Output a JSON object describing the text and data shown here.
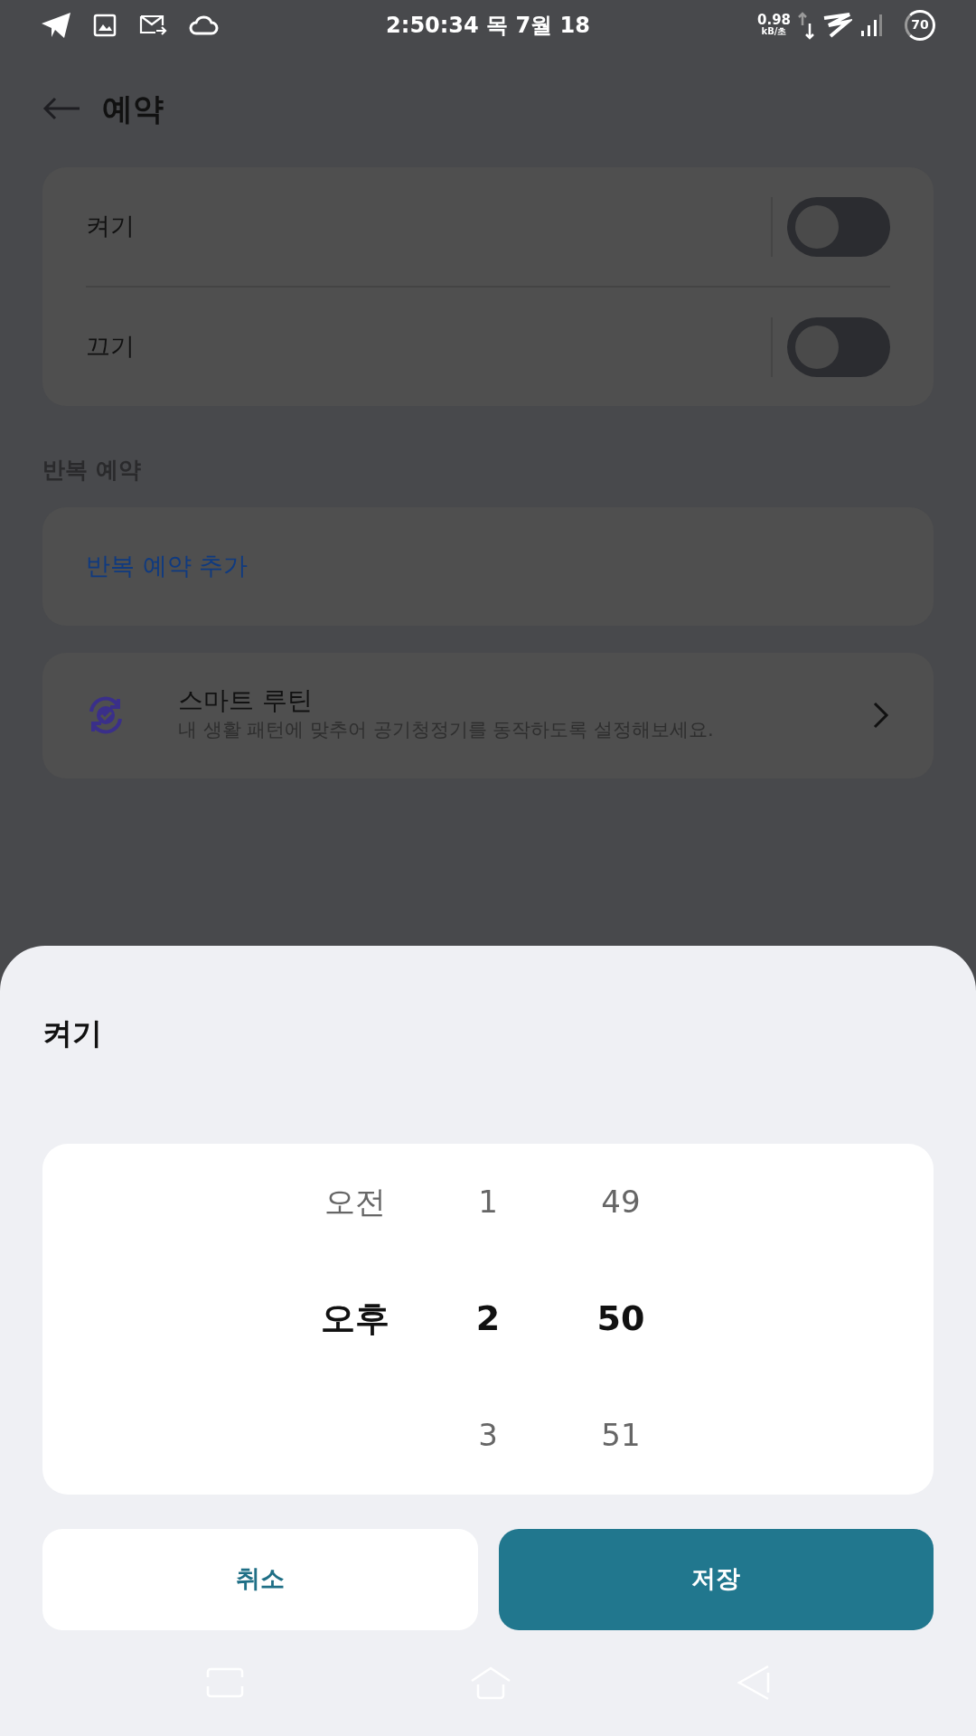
{
  "status_bar": {
    "time": "2:50:34 목 7월 18",
    "net_speed": "0.98",
    "net_unit": "kB/초",
    "battery": "70"
  },
  "header": {
    "title": "예약"
  },
  "toggles": [
    {
      "label": "켜기",
      "on": false
    },
    {
      "label": "끄기",
      "on": false
    }
  ],
  "repeat_section": {
    "title": "반복 예약",
    "add_label": "반복 예약 추가"
  },
  "routine": {
    "title": "스마트 루틴",
    "subtitle": "내 생활 패턴에 맞추어 공기청정기를 동작하도록 설정해보세요."
  },
  "sheet": {
    "title": "켜기",
    "picker": [
      {
        "items": [
          {
            "text": "오전",
            "selected": false
          },
          {
            "text": "오후",
            "selected": true
          }
        ]
      },
      {
        "items": [
          {
            "text": "1",
            "selected": false
          },
          {
            "text": "2",
            "selected": true
          },
          {
            "text": "3",
            "selected": false
          }
        ]
      },
      {
        "items": [
          {
            "text": "49",
            "selected": false
          },
          {
            "text": "50",
            "selected": true
          },
          {
            "text": "51",
            "selected": false
          }
        ]
      }
    ],
    "buttons": [
      {
        "label": "취소",
        "kind": "secondary"
      },
      {
        "label": "저장",
        "kind": "primary"
      }
    ]
  }
}
